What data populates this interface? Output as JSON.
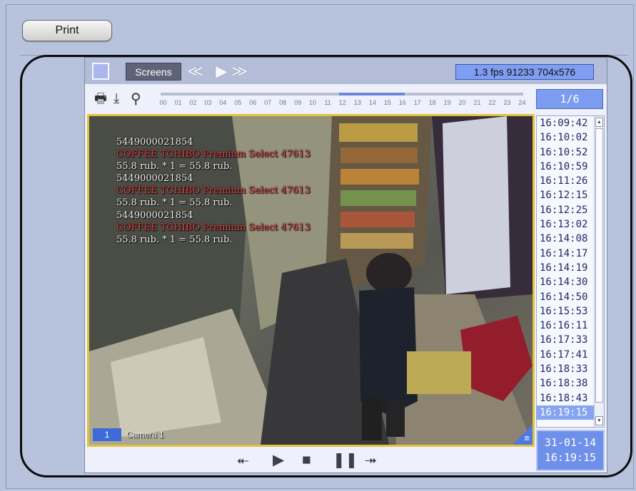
{
  "print_button": {
    "label": "Print"
  },
  "toolbar": {
    "screens_label": "Screens",
    "prev_icon": "≪",
    "play_icon": "▶",
    "next_icon": "≫",
    "stream_info": "1.3 fps  91233 704x576"
  },
  "timeline": {
    "print_icon": "🖶",
    "download_icon": "⤓",
    "zoom_icon": "⚲",
    "hours": [
      "00",
      "01",
      "02",
      "03",
      "04",
      "05",
      "06",
      "07",
      "08",
      "09",
      "10",
      "11",
      "12",
      "13",
      "14",
      "15",
      "16",
      "17",
      "18",
      "19",
      "20",
      "21",
      "22",
      "23",
      "24"
    ]
  },
  "page_indicator": "1/6",
  "video": {
    "overlay_lines": [
      {
        "text": "5449000021854",
        "color": "white"
      },
      {
        "text": "COFFEE TCHIBO Premium Select 47613",
        "color": "red"
      },
      {
        "text": "55.8 rub. * 1 = 55.8 rub.",
        "color": "white"
      },
      {
        "text": "5449000021854",
        "color": "white"
      },
      {
        "text": "COFFEE TCHIBO Premium Select 47613",
        "color": "red"
      },
      {
        "text": "55.8 rub. * 1 = 55.8 rub.",
        "color": "white"
      },
      {
        "text": "5449000021854",
        "color": "white"
      },
      {
        "text": "COFFEE TCHIBO Premium Select 47613",
        "color": "red"
      },
      {
        "text": "55.8 rub. * 1 = 55.8 rub.",
        "color": "white"
      }
    ],
    "camera_number": "1",
    "camera_name": "Camera 1",
    "menu_icon": "≡"
  },
  "timestamps": [
    "16:09:42",
    "16:10:02",
    "16:10:52",
    "16:10:59",
    "16:11:26",
    "16:12:15",
    "16:12:25",
    "16:13:02",
    "16:14:08",
    "16:14:17",
    "16:14:19",
    "16:14:30",
    "16:14:50",
    "16:15:53",
    "16:16:11",
    "16:17:33",
    "16:17:41",
    "16:18:33",
    "16:18:38",
    "16:18:43",
    "16:19:15"
  ],
  "selected_timestamp": "16:19:15",
  "datetime": {
    "date": "31-01-14",
    "time": "16:19:15"
  },
  "playback": {
    "prev_icon": "⯬",
    "play_icon": "▶",
    "stop_icon": "■",
    "pause_icon": "❚❚",
    "next_icon": "⯮"
  },
  "colors": {
    "accent": "#7b9cef",
    "video_border": "#e0c33b",
    "overlay_red": "#e23f3f"
  }
}
